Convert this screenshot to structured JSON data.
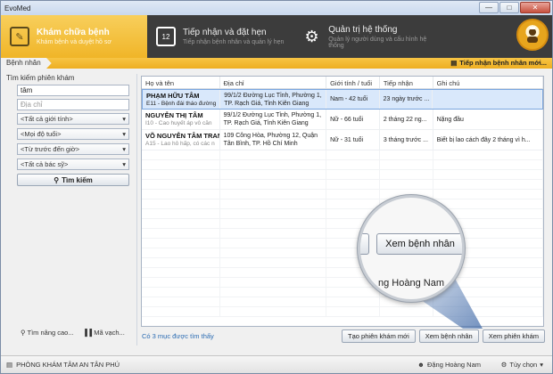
{
  "window": {
    "title": "EvoMed"
  },
  "ribbon": {
    "tabs": [
      {
        "title": "Khám chữa bệnh",
        "subtitle": "Khám bệnh và duyệt hồ sơ",
        "icon": "edit-icon"
      },
      {
        "title": "Tiếp nhận và đặt hẹn",
        "subtitle": "Tiếp nhận bệnh nhân và quản lý hẹn",
        "icon": "calendar-icon"
      },
      {
        "title": "Quản trị hệ thống",
        "subtitle": "Quản lý người dùng và cấu hình hệ thống",
        "icon": "gear-icon"
      }
    ]
  },
  "subbar": {
    "breadcrumb": "Bệnh nhân",
    "new_record": "Tiếp nhận bệnh nhân mới..."
  },
  "search": {
    "label": "Tìm kiếm phiên khám",
    "name_value": "tâm",
    "address_placeholder": "Địa chỉ",
    "filters": [
      "<Tất cả giới tính>",
      "<Mọi độ tuổi>",
      "<Từ trước đến giờ>",
      "<Tất cả bác sỹ>"
    ],
    "button": "Tìm kiếm",
    "advanced": "Tìm nâng cao...",
    "barcode": "Mã vạch..."
  },
  "table": {
    "headers": [
      "Họ và tên",
      "Địa chỉ",
      "Giới tính / tuổi",
      "Tiếp nhận",
      "Ghi chú"
    ],
    "rows": [
      {
        "name": "PHẠM HỮU TÂM",
        "sub": "E11 - Bệnh đái tháo đường",
        "address": "99/1/2 Đường Lục Tỉnh, Phường 1, TP. Rạch Giá, Tỉnh Kiên Giang",
        "gender_age": "Nam - 42 tuổi",
        "received": "23 ngày trước ...",
        "note": ""
      },
      {
        "name": "NGUYỄN THỊ TÂM",
        "sub": "I10 - Cao huyết áp vô căn",
        "address": "99/1/2 Đường Lục Tỉnh, Phường 1, TP. Rạch Giá, Tỉnh Kiên Giang",
        "gender_age": "Nữ - 66 tuổi",
        "received": "2 tháng 22 ng...",
        "note": "Nặng đầu"
      },
      {
        "name": "VÕ NGUYỄN TÂM TRANG",
        "sub": "A15 - Lao hô hấp, có các n",
        "address": "109 Công Hòa, Phường 12, Quận Tân Bình, TP. Hồ Chí Minh",
        "gender_age": "Nữ - 31 tuổi",
        "received": "3 tháng trước ...",
        "note": "Biết bị lao cách đây 2 tháng vì h..."
      }
    ]
  },
  "magnifier": {
    "button": "Xem bệnh nhân",
    "text": "ng Hoàng Nam"
  },
  "status": "Có 3 mục được tìm thấy",
  "actions": [
    "Tạo phiên khám mới",
    "Xem bệnh nhân",
    "Xem phiên khám"
  ],
  "footer": {
    "clinic": "PHÒNG KHÁM TÂM AN TÂN PHÚ",
    "user": "Đặng Hoàng Nam",
    "options": "Tùy chọn"
  }
}
